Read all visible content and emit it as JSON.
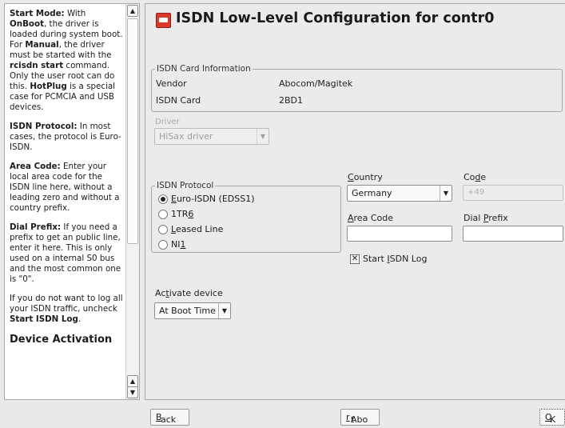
{
  "help": {
    "intro_start_mode_label": "Start Mode:",
    "intro_with": " With ",
    "onboot": "OnBoot",
    "intro_rest1": ", the driver is loaded during system boot. For ",
    "manual": "Manual",
    "intro_rest2": ", the driver must be started with the ",
    "rcisdn": "rcisdn start",
    "intro_rest3": " command. Only the user root can do this. ",
    "hotplug": "HotPlug",
    "intro_rest4": " is a special case for PCMCIA and USB devices.",
    "protocol_label": "ISDN Protocol:",
    "protocol_text": " In most cases, the protocol is Euro-ISDN.",
    "area_label": "Area Code:",
    "area_text": " Enter your local area code for the ISDN line here, without a leading zero and without a country prefix.",
    "dial_label": "Dial Prefix:",
    "dial_text": " If you need a prefix to get an public line, enter it here. This is only used on a internal S0 bus and the most common one is \"0\".",
    "log_text": "If you do not want to log all your ISDN traffic, uncheck ",
    "log_bold": "Start ISDN Log",
    "log_end": ".",
    "device_activation_heading": "Device Activation"
  },
  "main": {
    "title": "ISDN Low-Level Configuration for contr0",
    "card_info": {
      "legend": "ISDN Card Information",
      "rows": [
        {
          "label": "Vendor",
          "value": "Abocom/Magitek"
        },
        {
          "label": "ISDN Card",
          "value": "2BD1"
        }
      ]
    },
    "driver": {
      "label": "Driver",
      "value": "HiSax driver"
    },
    "protocol": {
      "legend": "ISDN Protocol",
      "options": [
        {
          "pre": "",
          "key": "E",
          "post": "uro-ISDN (EDSS1)",
          "selected": true
        },
        {
          "pre": "1TR",
          "key": "6",
          "post": "",
          "selected": false
        },
        {
          "pre": "",
          "key": "L",
          "post": "eased Line",
          "selected": false
        },
        {
          "pre": "NI",
          "key": "1",
          "post": "",
          "selected": false
        }
      ]
    },
    "country": {
      "label_key": "C",
      "label_rest": "ountry",
      "value": "Germany"
    },
    "code": {
      "label_pre": "Co",
      "label_key": "d",
      "label_post": "e",
      "value": "+49"
    },
    "area_code": {
      "label_key": "A",
      "label_rest": "rea Code",
      "value": ""
    },
    "dial_prefix": {
      "label_pre": "Dial ",
      "label_key": "P",
      "label_post": "refix",
      "value": ""
    },
    "start_log": {
      "pre": "Start ",
      "key": "I",
      "post": "SDN Log",
      "checked": true
    },
    "activate": {
      "label_pre": "Ac",
      "label_key": "t",
      "label_post": "ivate device",
      "value": "At Boot Time"
    }
  },
  "buttons": {
    "back": {
      "key": "B",
      "rest": "ack"
    },
    "abort": {
      "pre": "Abo",
      "key": "r",
      "post": "t"
    },
    "ok": {
      "key": "O",
      "rest": "K"
    }
  }
}
